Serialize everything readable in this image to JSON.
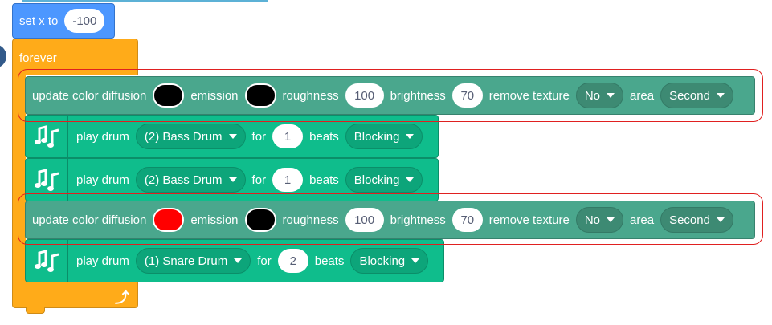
{
  "set_x": {
    "label": "set x to",
    "value": "-100"
  },
  "forever": {
    "label": "forever",
    "loop_icon": "loop-arrow-icon"
  },
  "color_update_1": {
    "label": "update color diffusion",
    "diffusion_color": "#000000",
    "emission_label": "emission",
    "emission_color": "#000000",
    "roughness_label": "roughness",
    "roughness_value": "100",
    "brightness_label": "brightness",
    "brightness_value": "70",
    "remove_texture_label": "remove texture",
    "remove_texture_value": "No",
    "area_label": "area",
    "area_value": "Second"
  },
  "drum_1": {
    "label": "play drum",
    "drum": "(2) Bass Drum",
    "for_label": "for",
    "beats_value": "1",
    "beats_label": "beats",
    "mode": "Blocking"
  },
  "drum_2": {
    "label": "play drum",
    "drum": "(2) Bass Drum",
    "for_label": "for",
    "beats_value": "1",
    "beats_label": "beats",
    "mode": "Blocking"
  },
  "color_update_2": {
    "label": "update color diffusion",
    "diffusion_color": "#ff0000",
    "emission_label": "emission",
    "emission_color": "#000000",
    "roughness_label": "roughness",
    "roughness_value": "100",
    "brightness_label": "brightness",
    "brightness_value": "70",
    "remove_texture_label": "remove texture",
    "remove_texture_value": "No",
    "area_label": "area",
    "area_value": "Second"
  },
  "drum_3": {
    "label": "play drum",
    "drum": "(1) Snare Drum",
    "for_label": "for",
    "beats_value": "2",
    "beats_label": "beats",
    "mode": "Blocking"
  },
  "colors": {
    "motion": "#4c97ff",
    "control": "#ffab19",
    "extension": "#0fbd8c",
    "highlight": "#e02020"
  },
  "icons": {
    "drum": "music-notes-icon"
  }
}
